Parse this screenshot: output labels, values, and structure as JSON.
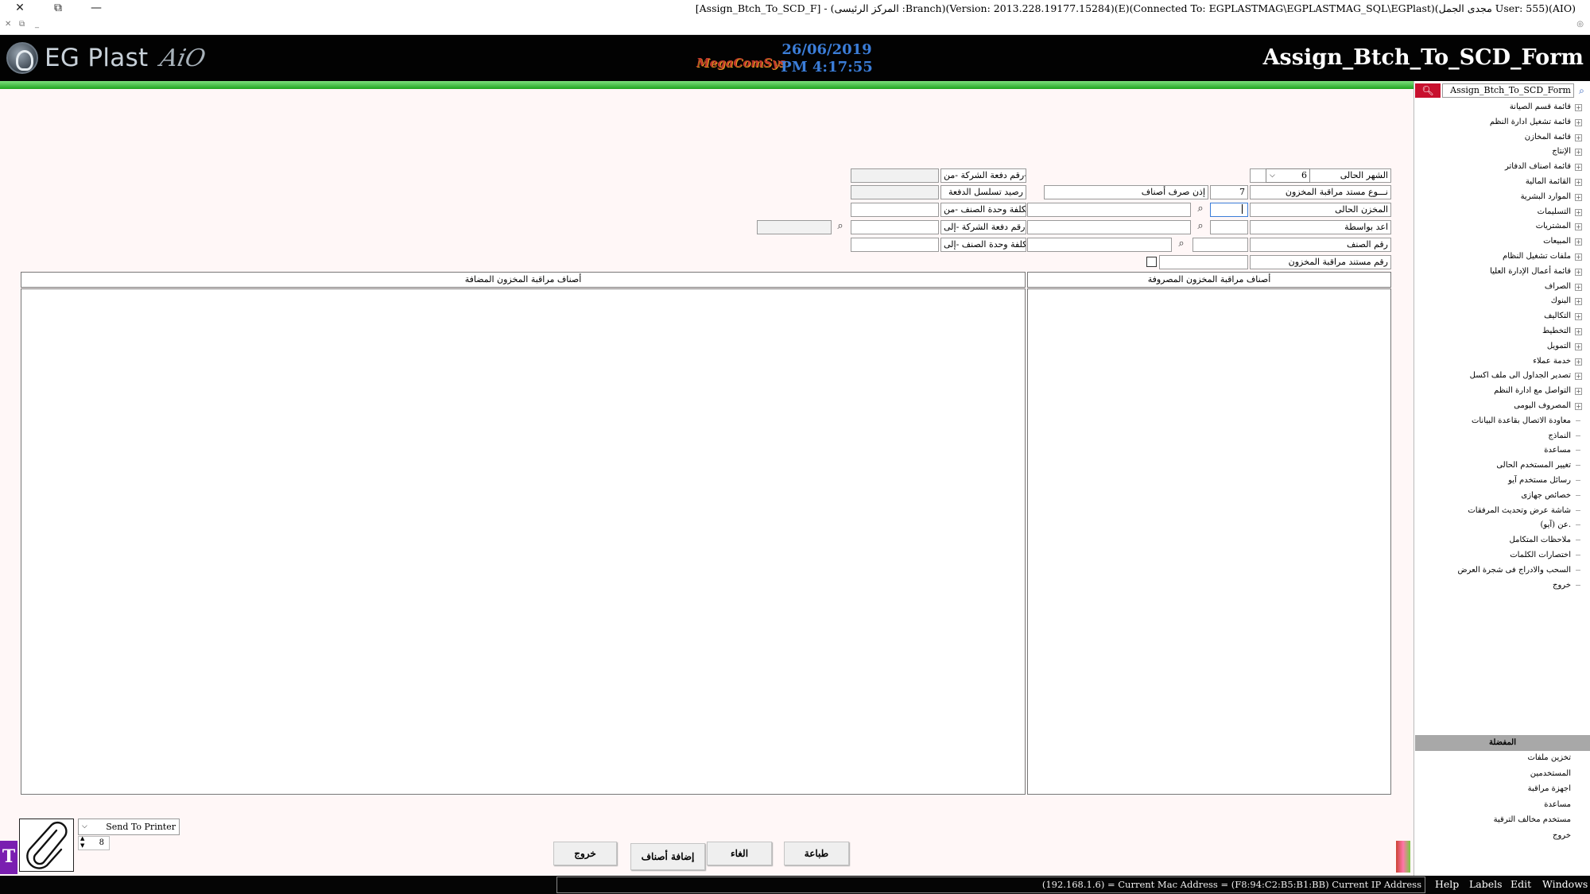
{
  "window": {
    "title": "[Assign_Btch_To_SCD_F] - (المركز الرئيسى :Branch)(Version: 2013.228.19177.15284)(E)(Connected To: EGPLASTMAG\\EGPLASTMAG_SQL\\EGPlast)(مجدى الجمل User: 555)(AIO)",
    "close": "✕",
    "restore": "⧉",
    "minimize": "—"
  },
  "header": {
    "logo_text": "EG Plast",
    "logo_suffix": "AiO",
    "vendor": "MegaComSys",
    "date": "26/06/2019",
    "time": "PM 4:17:55",
    "form_title": "Assign_Btch_To_SCD_Form"
  },
  "form": {
    "current_month_label": "الشهر الحالى",
    "current_month_value": "6",
    "doc_type_label": "نـــوع مستد مراقبة المخزون",
    "doc_type_code": "7",
    "doc_type_name": "إذن صرف أصناف",
    "current_store_label": "المخزن الحالى",
    "prepared_by_label": "اعد بواسطة",
    "item_no_label": "رقم الصنف",
    "doc_no_label": "رقم مستند مراقبة المخزون",
    "company_batch_from_label": "رقم دفعة الشركة -من-",
    "batch_balance_label": "رصيد تسلسل الدفعة",
    "unit_cost_from_label": "تكلفة وحدة الصنف -من-",
    "company_batch_to_label": "رقم دفعة الشركة -إلى-",
    "unit_cost_to_label": "تكلفة وحدة الصنف -إلى-"
  },
  "panels": {
    "consumed_header": "أصناف مراقبة المخزون المصروفة",
    "added_header": "أصناف مراقبة المخزون المضافة"
  },
  "buttons": {
    "exit": "خروج",
    "add_items": "إضافة أصناف",
    "cancel": "الغاء",
    "print": "طباعة"
  },
  "printer": {
    "selected": "Send To Printer",
    "copies": "8"
  },
  "tree": {
    "search_value": "Assign_Btch_To_SCD_Form",
    "items": [
      {
        "label": "قائمة قسم الصيانة",
        "expand": true
      },
      {
        "label": "قائمة تشغيل ادارة النظم",
        "expand": true
      },
      {
        "label": "قائمة المخازن",
        "expand": true
      },
      {
        "label": "الإنتاج",
        "expand": true
      },
      {
        "label": "قائمة اصناف الدفاتر",
        "expand": true
      },
      {
        "label": "القائمة المالية",
        "expand": true
      },
      {
        "label": "الموارد البشرية",
        "expand": true
      },
      {
        "label": "التسليمات",
        "expand": true
      },
      {
        "label": "المشتريات",
        "expand": true
      },
      {
        "label": "المبيعات",
        "expand": true
      },
      {
        "label": "ملفات تشغيل النظام",
        "expand": true
      },
      {
        "label": "قائمة أعمال الإدارة العليا",
        "expand": true
      },
      {
        "label": "الصراف",
        "expand": true
      },
      {
        "label": "البنوك",
        "expand": true
      },
      {
        "label": "التكاليف",
        "expand": true
      },
      {
        "label": "التخطيط",
        "expand": true
      },
      {
        "label": "التمويل",
        "expand": true
      },
      {
        "label": "خدمة عملاء",
        "expand": true
      },
      {
        "label": "تصدير الجداول الى ملف اكسل",
        "expand": true
      },
      {
        "label": "التواصل مع ادارة النظم",
        "expand": true
      },
      {
        "label": "المصروف اليومى",
        "expand": true
      },
      {
        "label": "معاودة الاتصال بقاعدة البيانات",
        "expand": false
      },
      {
        "label": "النماذج",
        "expand": false
      },
      {
        "label": "مساعدة",
        "expand": false
      },
      {
        "label": "تغيير المستخدم الحالى",
        "expand": false
      },
      {
        "label": "رسائل مستخدم آيو",
        "expand": false
      },
      {
        "label": "خصائص جهازى",
        "expand": false
      },
      {
        "label": "شاشة عرض وتحديث المرفقات",
        "expand": false
      },
      {
        "label": "عن (آيو).",
        "expand": false
      },
      {
        "label": "ملاحظات المتكامل",
        "expand": false
      },
      {
        "label": "اختصارات الكلمات",
        "expand": false
      },
      {
        "label": "السحب والادراج فى شجرة العرض",
        "expand": false
      },
      {
        "label": "خروج",
        "expand": false
      }
    ]
  },
  "favorites": {
    "header": "المفضلة",
    "items": [
      "تخزين ملفات",
      "المستخدمين",
      "اجهزة مراقبة",
      "مساعدة",
      "مستخدم مخالف الترقية",
      "خروج"
    ]
  },
  "statusbar": {
    "text": "(192.168.1.6) = Current Mac Address = (F8:94:C2:B5:B1:BB) Current IP Address",
    "menus": [
      "Help",
      "Labels",
      "Edit",
      "Windows"
    ]
  },
  "colors": {
    "header_bg": "#020202",
    "green_bar": "#1fa41f",
    "accent_red": "#c8102e",
    "datetime": "#3b7dd8"
  }
}
